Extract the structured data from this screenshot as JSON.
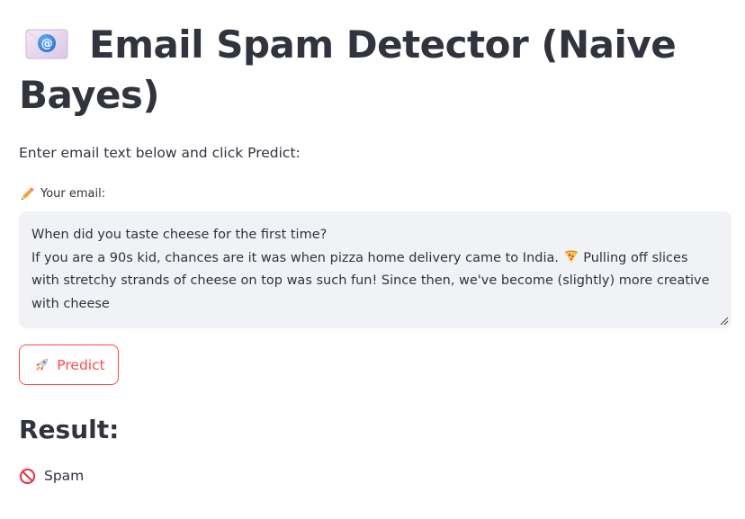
{
  "header": {
    "title_icon": "envelope-at-icon",
    "title": "Email Spam Detector (Naive Bayes)"
  },
  "intro_text": "Enter email text below and click Predict:",
  "email_input": {
    "label_icon": "pencil-icon",
    "label": "Your email:",
    "value_line1": "When did you taste cheese for the first time?",
    "value_line2_before_emoji": "If you are a 90s kid, chances are it was when pizza home delivery came to India. ",
    "value_emoji": "pizza-icon",
    "value_line2_after_emoji": " Pulling off slices with stretchy strands of cheese on top was such fun! Since then, we've become (slightly) more creative with cheese"
  },
  "predict_button": {
    "icon": "rocket-icon",
    "label": "Predict",
    "color": "#ff4b4b"
  },
  "result": {
    "heading": "Result:",
    "icon": "no-entry-icon",
    "label": "Spam",
    "icon_color": "#e8384f"
  }
}
